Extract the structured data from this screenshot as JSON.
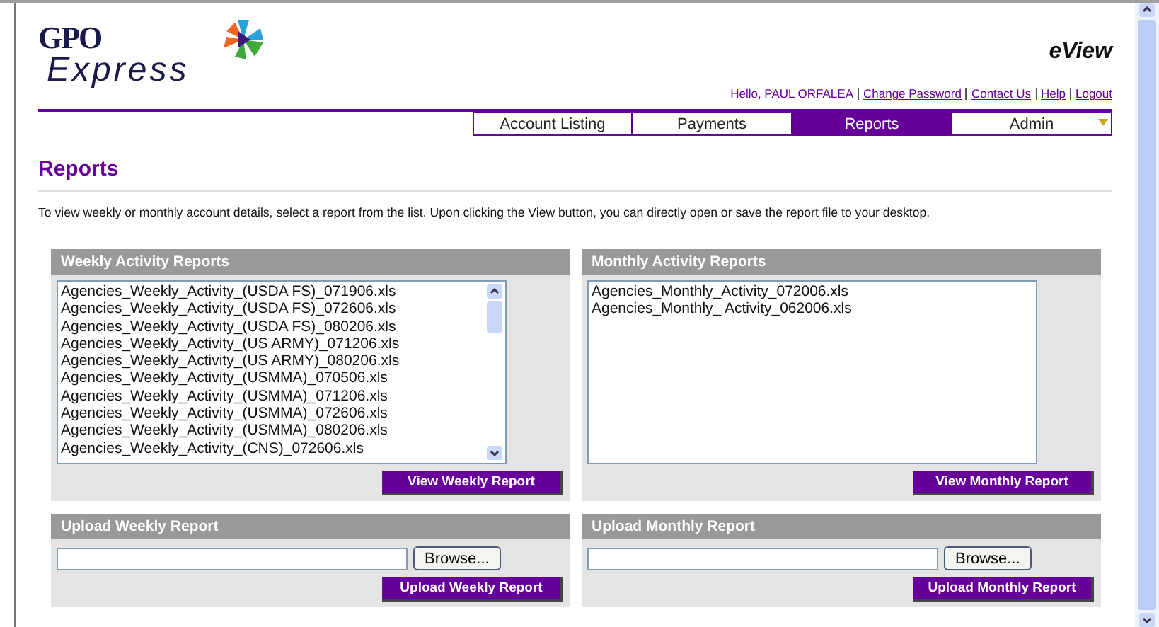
{
  "logo": {
    "line_1": "GPO",
    "line_2": "Express"
  },
  "app_title": "eView",
  "user_links": {
    "greeting": "Hello, PAUL ORFALEA",
    "links": [
      "Change Password",
      "Contact Us",
      "Help",
      "Logout"
    ]
  },
  "nav_tabs": [
    {
      "label": "Account Listing",
      "selected": false,
      "has_menu": false
    },
    {
      "label": "Payments",
      "selected": false,
      "has_menu": false
    },
    {
      "label": "Reports",
      "selected": true,
      "has_menu": false
    },
    {
      "label": "Admin",
      "selected": false,
      "has_menu": true
    }
  ],
  "page_title": "Reports",
  "intro": "To view weekly or monthly account details, select a report from the list. Upon clicking the View button, you can directly open or save the report file to your desktop.",
  "report_panels": [
    {
      "title": "Weekly Activity Reports",
      "scrollable": true,
      "items": [
        "Agencies_Weekly_Activity_(USDA FS)_071906.xls",
        "Agencies_Weekly_Activity_(USDA FS)_072606.xls",
        "Agencies_Weekly_Activity_(USDA FS)_080206.xls",
        "Agencies_Weekly_Activity_(US ARMY)_071206.xls",
        "Agencies_Weekly_Activity_(US ARMY)_080206.xls",
        "Agencies_Weekly_Activity_(USMMA)_070506.xls",
        "Agencies_Weekly_Activity_(USMMA)_071206.xls",
        "Agencies_Weekly_Activity_(USMMA)_072606.xls",
        "Agencies_Weekly_Activity_(USMMA)_080206.xls",
        "Agencies_Weekly_Activity_(CNS)_072606.xls"
      ],
      "button": "View Weekly Report"
    },
    {
      "title": "Monthly Activity Reports",
      "scrollable": false,
      "items": [
        "Agencies_Monthly_Activity_072006.xls",
        "Agencies_Monthly_ Activity_062006.xls"
      ],
      "button": "View Monthly Report"
    }
  ],
  "upload_panels": [
    {
      "title": "Upload Weekly Report",
      "browse": "Browse...",
      "button": "Upload Weekly Report"
    },
    {
      "title": "Upload Monthly Report",
      "browse": "Browse...",
      "button": "Upload Monthly Report"
    }
  ]
}
